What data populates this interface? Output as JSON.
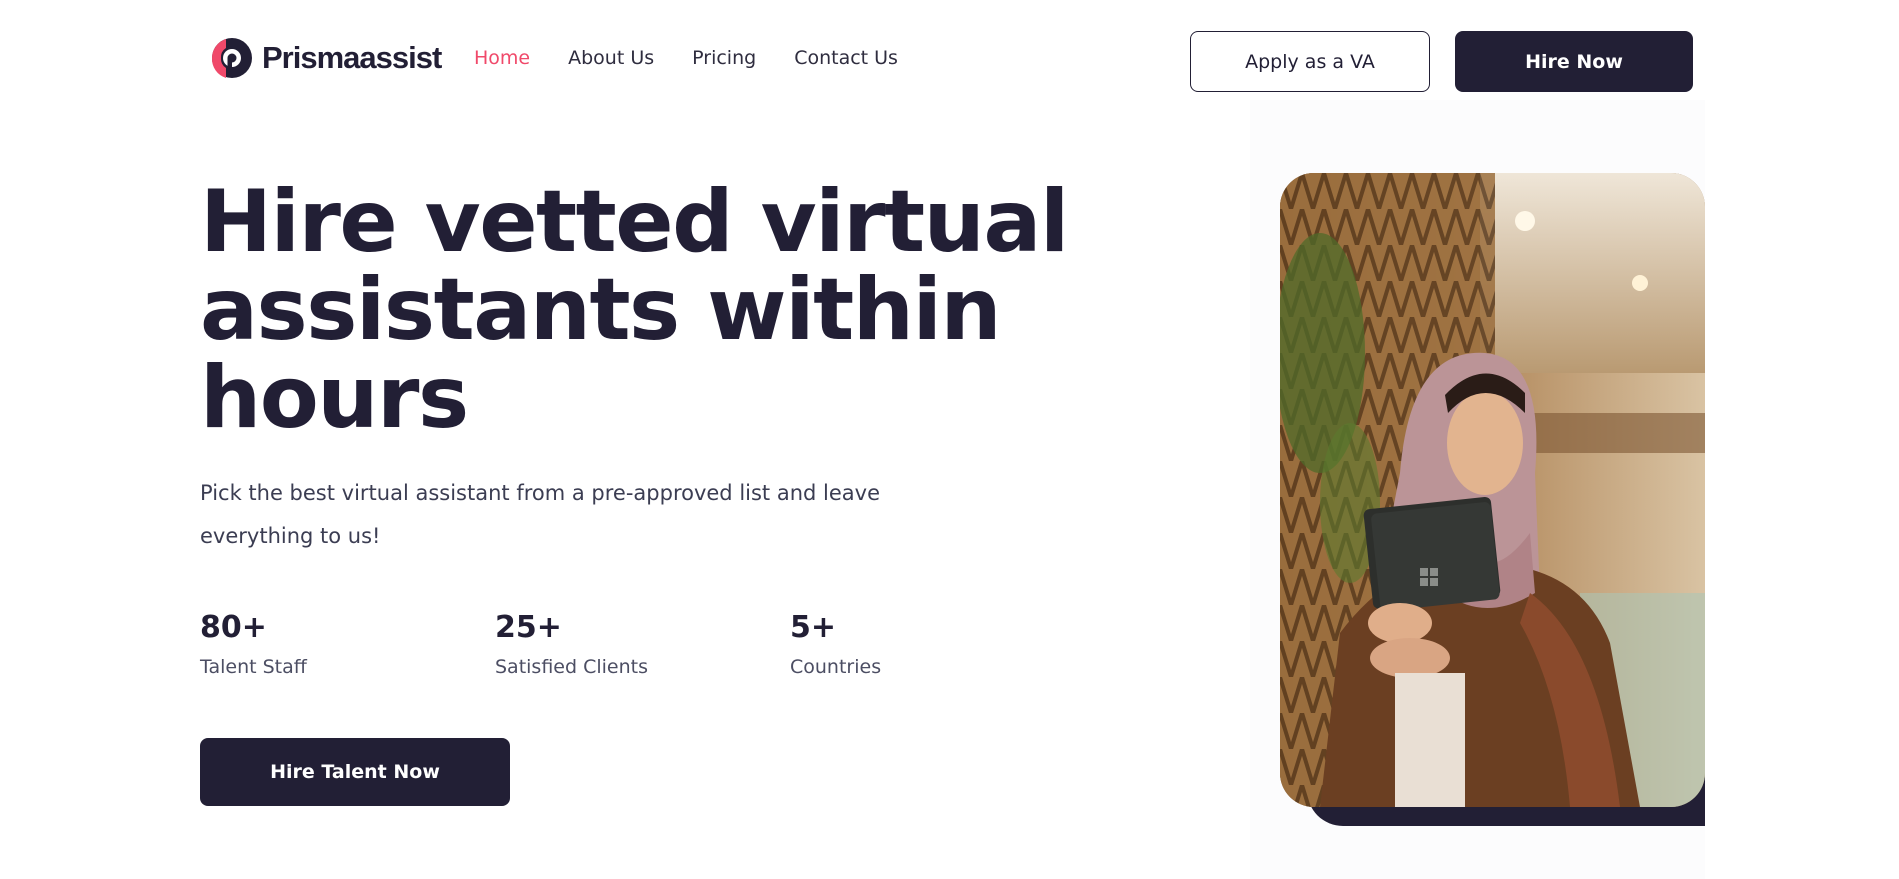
{
  "brand": {
    "name": "Prismaassist",
    "accent": "#f0496a",
    "dark": "#221f35"
  },
  "nav": {
    "items": [
      {
        "label": "Home",
        "active": true
      },
      {
        "label": "About Us",
        "active": false
      },
      {
        "label": "Pricing",
        "active": false
      },
      {
        "label": "Contact Us",
        "active": false
      }
    ]
  },
  "header_actions": {
    "apply_label": "Apply as a VA",
    "hire_label": "Hire Now"
  },
  "hero": {
    "title_lines": [
      "Hire vetted virtual",
      "assistants within",
      "hours"
    ],
    "subtitle": "Pick the best virtual assistant from a pre-approved list and leave everything to us!",
    "stats": [
      {
        "value": "80+",
        "label": "Talent Staff"
      },
      {
        "value": "25+",
        "label": "Satisfied Clients"
      },
      {
        "value": "5+",
        "label": "Countries"
      }
    ],
    "cta_label": "Hire Talent Now",
    "image": {
      "subject": "woman-in-hijab-holding-laptop-photo"
    }
  }
}
